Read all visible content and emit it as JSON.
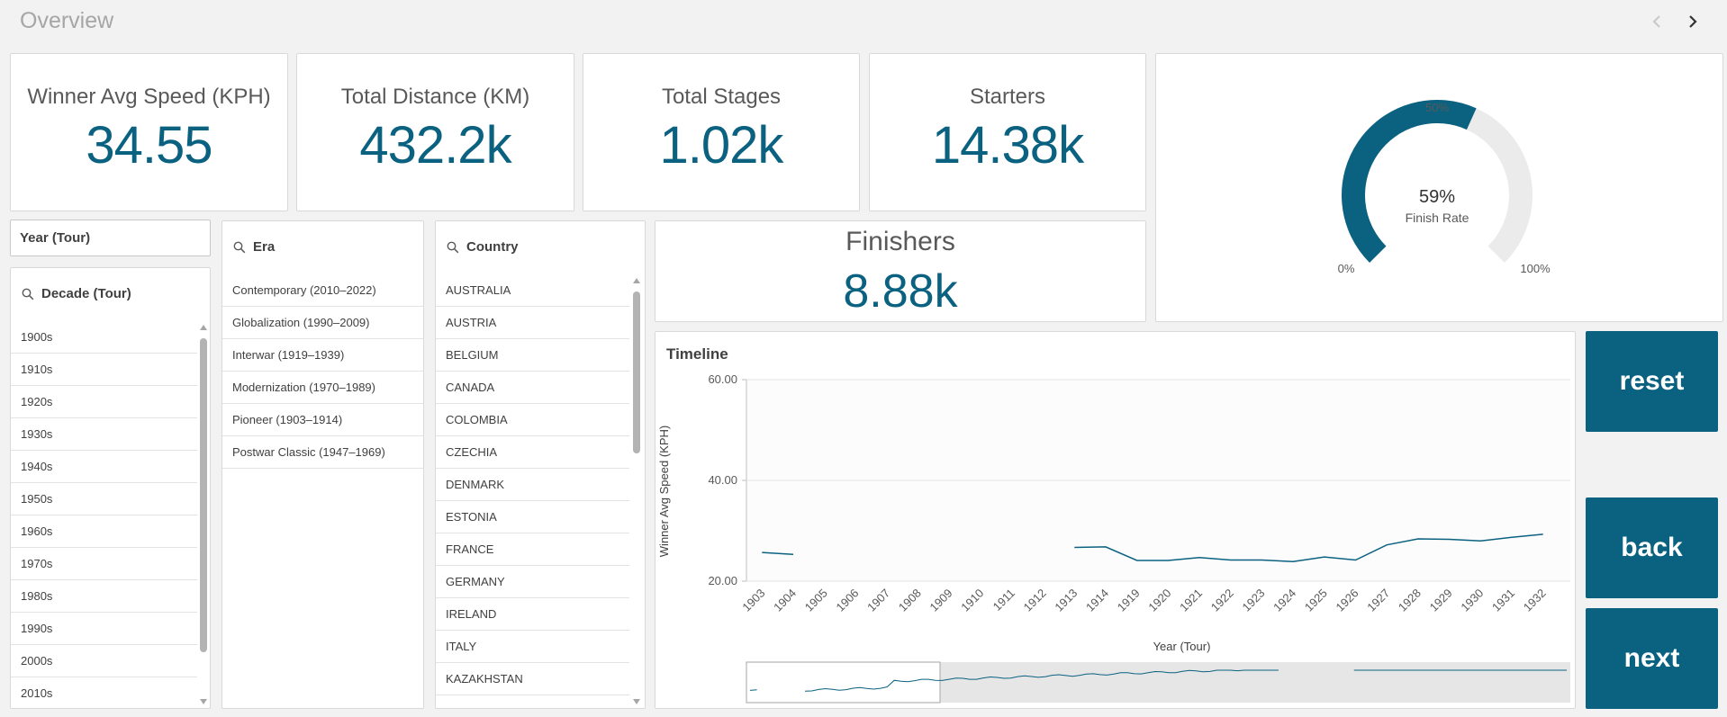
{
  "header": {
    "title": "Overview"
  },
  "kpis": {
    "avg_speed": {
      "label": "Winner Avg Speed (KPH)",
      "value": "34.55"
    },
    "distance": {
      "label": "Total Distance (KM)",
      "value": "432.2k"
    },
    "stages": {
      "label": "Total Stages",
      "value": "1.02k"
    },
    "starters": {
      "label": "Starters",
      "value": "14.38k"
    },
    "finishers": {
      "label": "Finishers",
      "value": "8.88k"
    }
  },
  "gauge": {
    "value_text": "59%",
    "label": "Finish Rate",
    "fraction": 0.59,
    "min_label": "0%",
    "mid_label": "50%",
    "max_label": "100%",
    "fill_color": "#0a6180",
    "track_color": "#ebebeb"
  },
  "filters": {
    "year": {
      "label": "Year (Tour)"
    },
    "decade": {
      "label": "Decade (Tour)",
      "items": [
        "1900s",
        "1910s",
        "1920s",
        "1930s",
        "1940s",
        "1950s",
        "1960s",
        "1970s",
        "1980s",
        "1990s",
        "2000s",
        "2010s"
      ]
    },
    "era": {
      "label": "Era",
      "items": [
        "Contemporary (2010–2022)",
        "Globalization (1990–2009)",
        "Interwar (1919–1939)",
        "Modernization (1970–1989)",
        "Pioneer (1903–1914)",
        "Postwar Classic (1947–1969)"
      ]
    },
    "country": {
      "label": "Country",
      "items": [
        "AUSTRALIA",
        "AUSTRIA",
        "BELGIUM",
        "CANADA",
        "COLOMBIA",
        "CZECHIA",
        "DENMARK",
        "ESTONIA",
        "FRANCE",
        "GERMANY",
        "IRELAND",
        "ITALY",
        "KAZAKHSTAN"
      ]
    }
  },
  "buttons": {
    "reset": "reset",
    "back": "back",
    "next": "next"
  },
  "chart_data": {
    "type": "line",
    "title": "Timeline",
    "xlabel": "Year (Tour)",
    "ylabel": "Winner Avg Speed (KPH)",
    "ylim": [
      20,
      60
    ],
    "yticks": [
      "20.00",
      "40.00",
      "60.00"
    ],
    "grid": true,
    "categories": [
      "1903",
      "1904",
      "1905",
      "1906",
      "1907",
      "1908",
      "1909",
      "1910",
      "1911",
      "1912",
      "1913",
      "1914",
      "1919",
      "1920",
      "1921",
      "1922",
      "1923",
      "1924",
      "1925",
      "1926",
      "1927",
      "1928",
      "1929",
      "1930",
      "1931",
      "1932"
    ],
    "series": [
      {
        "values": [
          25.7,
          25.3,
          null,
          null,
          null,
          null,
          null,
          null,
          null,
          null,
          26.7,
          26.8,
          24.1,
          24.1,
          24.7,
          24.2,
          24.2,
          23.9,
          24.8,
          24.2,
          27.2,
          28.4,
          28.3,
          28.0,
          28.7,
          29.3
        ]
      }
    ],
    "line_color": "#0a6180"
  }
}
